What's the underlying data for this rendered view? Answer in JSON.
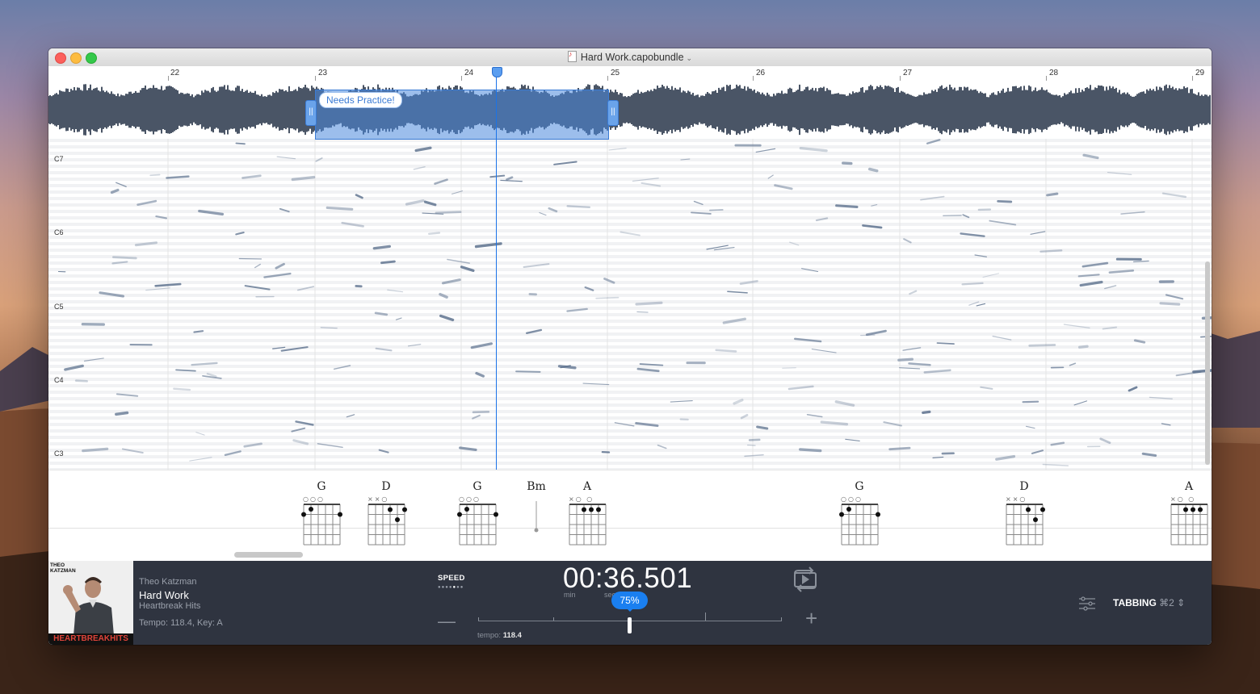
{
  "window": {
    "title": "Hard Work.capobundle"
  },
  "ruler": {
    "bars": [
      "22",
      "23",
      "24",
      "25",
      "26",
      "27",
      "28",
      "29"
    ]
  },
  "loop_region": {
    "label": "Needs Practice!"
  },
  "piano_roll": {
    "note_labels": [
      "C7",
      "C6",
      "C5",
      "C4",
      "C3"
    ]
  },
  "chords": [
    "G",
    "D",
    "G",
    "Bm",
    "A",
    "G",
    "D",
    "A"
  ],
  "album": {
    "top_text": "THEO KATZMAN",
    "bottom_text": "HEARTBREAKHITS"
  },
  "track": {
    "artist": "Theo Katzman",
    "title": "Hard Work",
    "album": "Heartbreak Hits",
    "info": "Tempo: 118.4, Key: A"
  },
  "speed": {
    "label": "SPEED",
    "percent": "75%",
    "tempo_label": "tempo:",
    "tempo_value": "118.4"
  },
  "time": {
    "display": "00:36.501",
    "unit_min": "min",
    "unit_sec": "sec"
  },
  "mode": {
    "label": "TABBING",
    "shortcut": "⌘2"
  },
  "icons": [
    "loop-play-icon",
    "settings-icon",
    "chevron-updown-icon",
    "minus-icon",
    "plus-icon"
  ]
}
